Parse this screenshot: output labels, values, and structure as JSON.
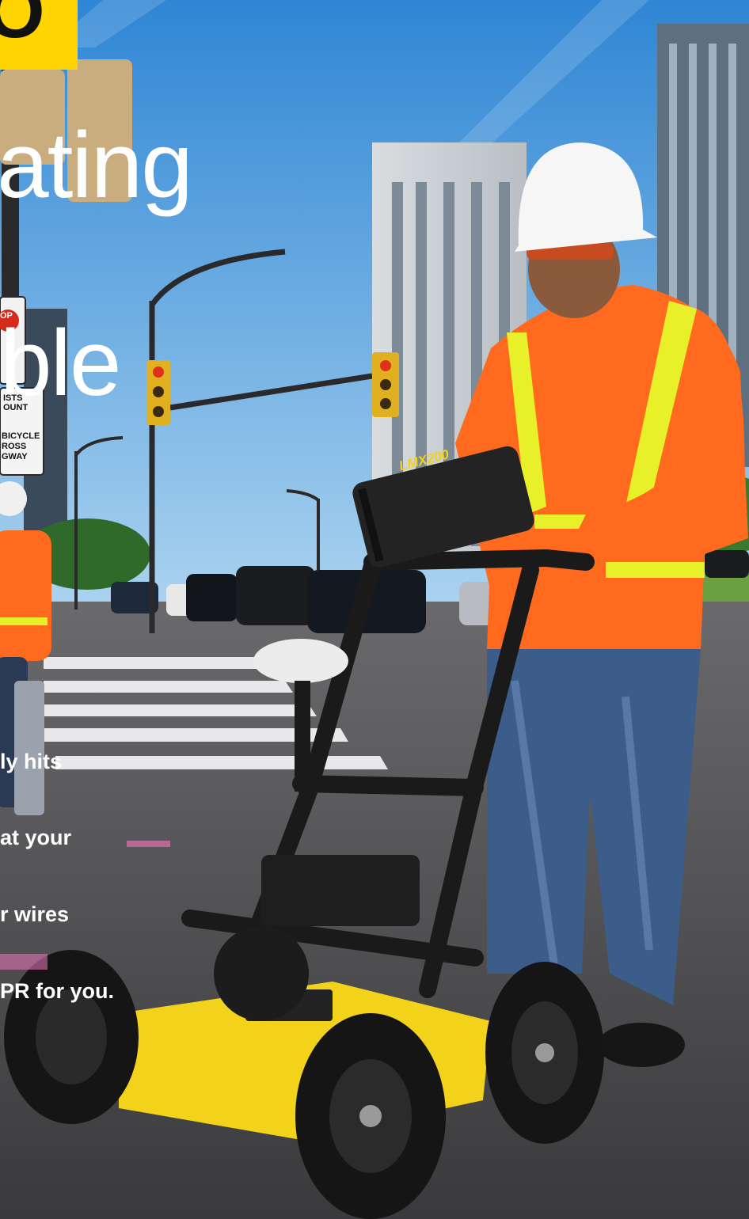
{
  "logo": {
    "glyph": "O",
    "color": "#ffd400"
  },
  "headline": {
    "line1": "ating",
    "line2": "ble"
  },
  "body_lines": [
    "ly hits",
    "at your",
    "r wires",
    "PR for you."
  ],
  "signs": {
    "stop": "OP",
    "sign1_line1": "ISTS",
    "sign1_line2": "OUNT",
    "sign2_line1": "BICYCLE",
    "sign2_line2": "ROSS",
    "sign2_line3": "GWAY"
  },
  "device": {
    "brand": "LMX200"
  },
  "colors": {
    "sky_top": "#2f86d4",
    "sky_bottom": "#9cc9ec",
    "vest": "#ff6a1f",
    "stripe": "#e8f02a",
    "cart": "#f2d21a",
    "asphalt": "#4a4a4c"
  }
}
